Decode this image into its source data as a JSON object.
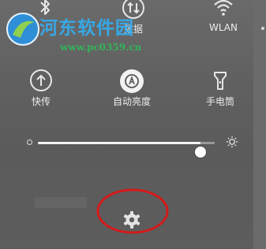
{
  "quick_settings": {
    "row1": [
      {
        "label": "",
        "icon": "bluetooth-icon"
      },
      {
        "label": "数据",
        "icon": "mobile-data-icon"
      },
      {
        "label": "WLAN",
        "icon": "wifi-icon"
      }
    ],
    "row2": [
      {
        "label": "快传",
        "icon": "quick-transfer-icon"
      },
      {
        "label": "自动亮度",
        "icon": "auto-brightness-icon"
      },
      {
        "label": "手电筒",
        "icon": "flashlight-icon"
      }
    ]
  },
  "brightness": {
    "level": 0.92,
    "min_icon": "brightness-low-icon",
    "max_icon": "brightness-high-icon"
  },
  "settings": {
    "icon": "settings-gear-icon"
  },
  "watermark": {
    "title": "河东软件园",
    "url": "www.pc0359.cn"
  },
  "colors": {
    "panel_bg": "#5f5f5f",
    "text": "#ececec",
    "watermark_blue": "#37a8e6",
    "watermark_green": "#33b35a",
    "annotation_red": "#d41a1a"
  }
}
